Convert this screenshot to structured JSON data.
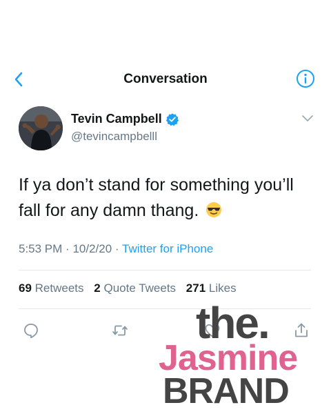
{
  "header": {
    "title": "Conversation"
  },
  "tweet": {
    "display_name": "Tevin Campbell",
    "handle": "@tevincampbelll",
    "text": "If ya don’t stand for something you’ll fall for any damn thang.",
    "emoji": "sunglasses-face",
    "time": "5:53 PM",
    "separator": "·",
    "date": "10/2/20",
    "source": "Twitter for iPhone"
  },
  "stats": {
    "retweets_count": "69",
    "retweets_label": "Retweets",
    "quotes_count": "2",
    "quotes_label": "Quote Tweets",
    "likes_count": "271",
    "likes_label": "Likes"
  },
  "actions": [
    "reply-icon",
    "retweet-icon",
    "like-icon",
    "share-icon"
  ],
  "watermark": {
    "line1": "the.",
    "line2": "Jasmine",
    "line3": "BRAND"
  },
  "colors": {
    "accent": "#1da1f2",
    "secondary_text": "#657786",
    "watermark_pink": "#e0628e",
    "watermark_gray": "#444444"
  }
}
